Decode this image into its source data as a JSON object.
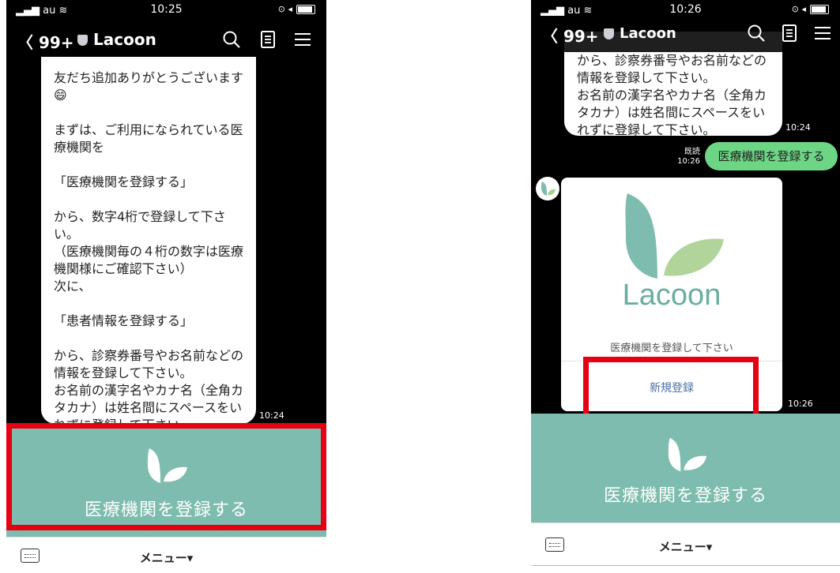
{
  "status": {
    "carrier": "au",
    "left_time": "10:25",
    "right_time": "10:26"
  },
  "chat": {
    "back_count": "99+",
    "title": "Lacoon",
    "icons": {
      "search": "search-icon",
      "notes": "notes-icon",
      "menu": "hamburger-menu-icon",
      "shield": "shield-icon",
      "keyboard": "keyboard-icon"
    }
  },
  "screen1": {
    "message": "友だち追加ありがとうございます\n😄\n\nまずは、ご利用になられている医療機関を\n\n「医療機関を登録する」\n\nから、数字4桁で登録して下さい。\n（医療機関毎の４桁の数字は医療機関様にご確認下さい）\n次に、\n\n「患者情報を登録する」\n\nから、診察券番号やお名前などの情報を登録して下さい。\nお名前の漢字名やカナ名（全角カタカナ）は姓名間にスペースをいれずに登録して下さい。",
    "message_time": "10:24",
    "richmenu_label": "医療機関を登録する",
    "menu_label": "メニュー▾"
  },
  "screen2": {
    "message": "から、診察券番号やお名前などの情報を登録して下さい。\nお名前の漢字名やカナ名（全角カタカナ）は姓名間にスペースをいれずに登録して下さい。",
    "message_time": "10:24",
    "sent_message": "医療機関を登録する",
    "read_label": "既読",
    "sent_time": "10:26",
    "card": {
      "logo_text": "Lacoon",
      "prompt": "医療機関を登録して下さい",
      "button": "新規登録",
      "time": "10:26"
    },
    "richmenu_label": "医療機関を登録する",
    "menu_label": "メニュー▾"
  },
  "colors": {
    "accent": "#7dbcae",
    "sent_bubble": "#6cd685",
    "highlight": "#e60012",
    "link": "#4a6fa5"
  }
}
